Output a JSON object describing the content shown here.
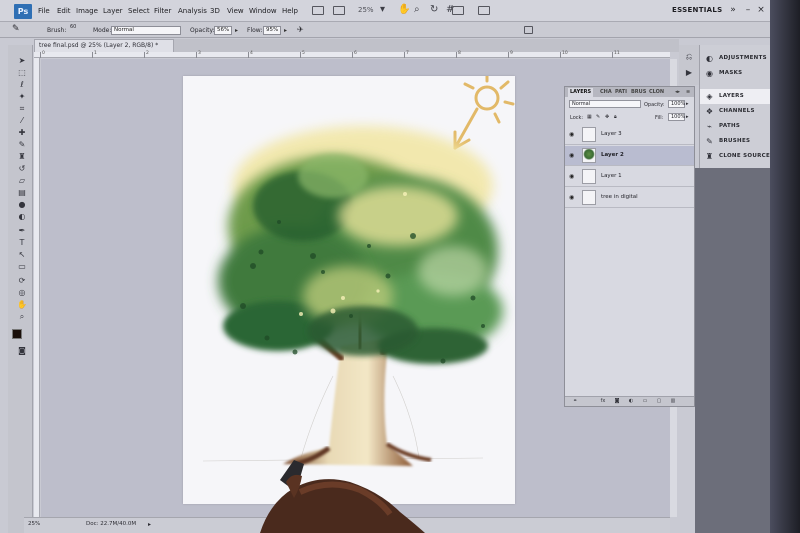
{
  "app": {
    "logo": "Ps",
    "workspace": "ESSENTIALS"
  },
  "menu": {
    "items": [
      "File",
      "Edit",
      "Image",
      "Layer",
      "Select",
      "Filter",
      "Analysis",
      "3D",
      "View",
      "Window",
      "Help"
    ],
    "zoom": "25%"
  },
  "options": {
    "brush_label": "Brush:",
    "brush_size": "60",
    "mode_label": "Mode:",
    "mode_value": "Normal",
    "opacity_label": "Opacity:",
    "opacity_value": "56%",
    "flow_label": "Flow:",
    "flow_value": "95%"
  },
  "document": {
    "tab_title": "tree final.psd @ 25% (Layer 2, RGB/8) *",
    "status_zoom": "25%",
    "status_doc": "Doc: 22.7M/40.0M"
  },
  "rulers": {
    "top_numbers": [
      "0",
      "1",
      "2",
      "3",
      "4",
      "5",
      "6",
      "7",
      "8",
      "9",
      "10",
      "11"
    ]
  },
  "dock": {
    "items": [
      {
        "label": "ADJUSTMENTS",
        "icon": "adjustments-icon"
      },
      {
        "label": "MASKS",
        "icon": "masks-icon"
      },
      {
        "label": "LAYERS",
        "icon": "layers-icon"
      },
      {
        "label": "CHANNELS",
        "icon": "channels-icon"
      },
      {
        "label": "PATHS",
        "icon": "paths-icon"
      },
      {
        "label": "BRUSHES",
        "icon": "brushes-icon"
      },
      {
        "label": "CLONE SOURCE",
        "icon": "clone-source-icon"
      }
    ]
  },
  "layers_panel": {
    "tabs": [
      "LAYERS",
      "CHA",
      "PATI",
      "BRUS",
      "CLON"
    ],
    "blend_mode": "Normal",
    "opacity_label": "Opacity:",
    "opacity_value": "100%",
    "lock_label": "Lock:",
    "fill_label": "Fill:",
    "fill_value": "100%",
    "layers": [
      {
        "name": "Layer 3",
        "selected": false
      },
      {
        "name": "Layer 2",
        "selected": true
      },
      {
        "name": "Layer 1",
        "selected": false
      },
      {
        "name": "tree in digital",
        "selected": false
      }
    ]
  },
  "colors": {
    "foreground": "#1a0f0a",
    "background": "#ffffff",
    "accent": "#2f6fb4"
  }
}
